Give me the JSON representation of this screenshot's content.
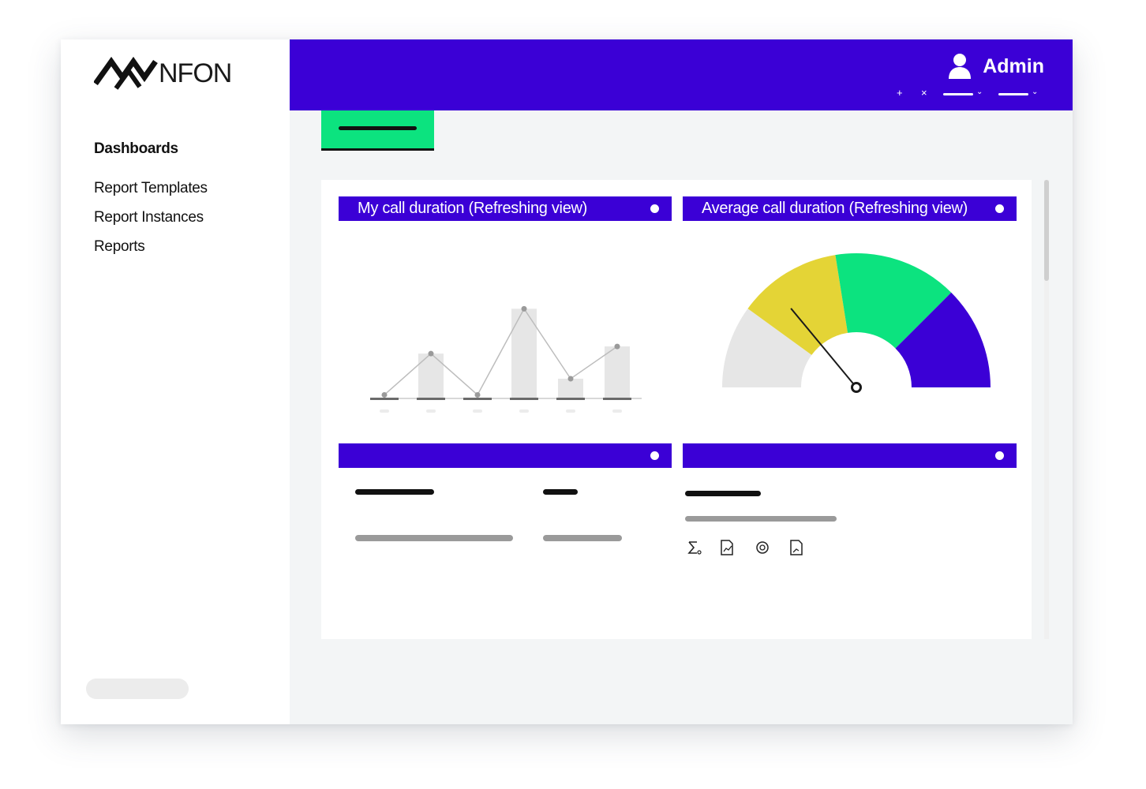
{
  "brand": {
    "name": "NFON"
  },
  "sidebar": {
    "heading": "Dashboards",
    "items": [
      {
        "label": "Report Templates"
      },
      {
        "label": "Report Instances"
      },
      {
        "label": "Reports"
      }
    ]
  },
  "topbar": {
    "user_label": "Admin",
    "add_label": "+",
    "close_label": "×"
  },
  "widgets": [
    {
      "title": "My call duration (Refreshing view)"
    },
    {
      "title": "Average call duration (Refreshing view)"
    },
    {
      "title": ""
    },
    {
      "title": ""
    }
  ],
  "colors": {
    "primary": "#3b00d6",
    "accent_green": "#0ce37f",
    "gauge_yellow": "#e4d436",
    "gauge_grey": "#e6e6e6"
  },
  "chart_data": [
    {
      "type": "bar",
      "categories": [
        "",
        "",
        "",
        "",
        "",
        ""
      ],
      "series": [
        {
          "values": [
            0,
            50,
            0,
            100,
            22,
            58
          ]
        }
      ],
      "overlay_line": [
        4,
        50,
        4,
        100,
        22,
        58
      ],
      "ylim": [
        0,
        110
      ],
      "grid": false
    },
    {
      "type": "gauge",
      "segments": [
        {
          "color": "#e6e6e6",
          "from": 0,
          "to": 20
        },
        {
          "color": "#e4d436",
          "from": 20,
          "to": 45
        },
        {
          "color": "#0ce37f",
          "from": 45,
          "to": 75
        },
        {
          "color": "#3b00d6",
          "from": 75,
          "to": 100
        }
      ],
      "value": 28
    }
  ],
  "icons": [
    "sum-icon",
    "report-chart-icon",
    "target-icon",
    "report-edit-icon"
  ]
}
